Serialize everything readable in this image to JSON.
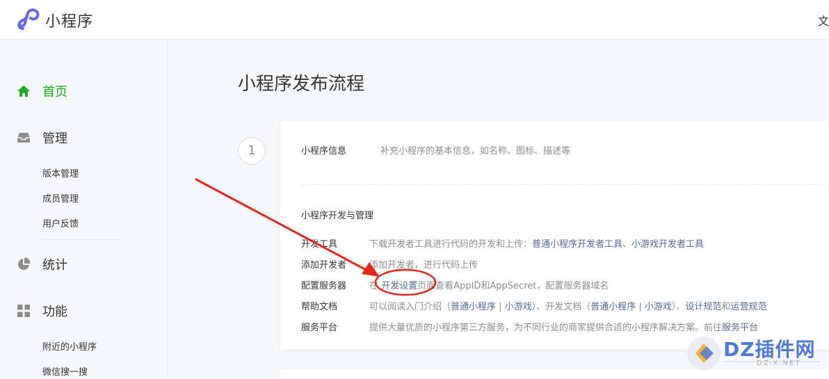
{
  "header": {
    "brand": "小程序",
    "right_text": "文"
  },
  "sidebar": {
    "home": "首页",
    "manage": "管理",
    "manage_items": [
      "版本管理",
      "成员管理",
      "用户反馈"
    ],
    "stats": "统计",
    "features": "功能",
    "feature_items": [
      "附近的小程序",
      "微信搜一搜"
    ]
  },
  "main": {
    "title": "小程序发布流程",
    "step": "1",
    "info": {
      "label": "小程序信息",
      "desc": "补充小程序的基本信息，如名称、图标、描述等"
    },
    "section_title": "小程序开发与管理",
    "rows": {
      "dev_tools": {
        "label": "开发工具",
        "desc": "下载开发者工具进行代码的开发和上传：",
        "link1": "普通小程序开发者工具",
        "sep": "、",
        "link2": "小游戏开发者工具"
      },
      "add_dev": {
        "label": "添加开发者",
        "desc": "添加开发者，进行代码上传"
      },
      "server": {
        "label": "配置服务器",
        "pre": "在",
        "link": "开发设置",
        "post": "页面查看AppID和AppSecret，配置服务器域名"
      },
      "help": {
        "label": "帮助文档",
        "t1": "可以阅读入门介绍（",
        "l1": "普通小程序",
        "s1": " | ",
        "l2": "小游戏",
        "t2": "）、开发文档（",
        "l3": "普通小程序",
        "s2": " | ",
        "l4": "小游戏",
        "t3": "）、",
        "l5": "设计规范",
        "t4": "和",
        "l6": "运营规范"
      },
      "service": {
        "label": "服务平台",
        "desc": "提供大量优质的小程序第三方服务，为不同行业的商家提供合适的小程序解决方案。前往",
        "link": "服务平台"
      }
    }
  },
  "watermark": {
    "text": "DZ插件网",
    "sub": "DZ-X.NET"
  },
  "colors": {
    "accent": "#1aad19",
    "link": "#576b95",
    "annotation": "#e8231c"
  }
}
